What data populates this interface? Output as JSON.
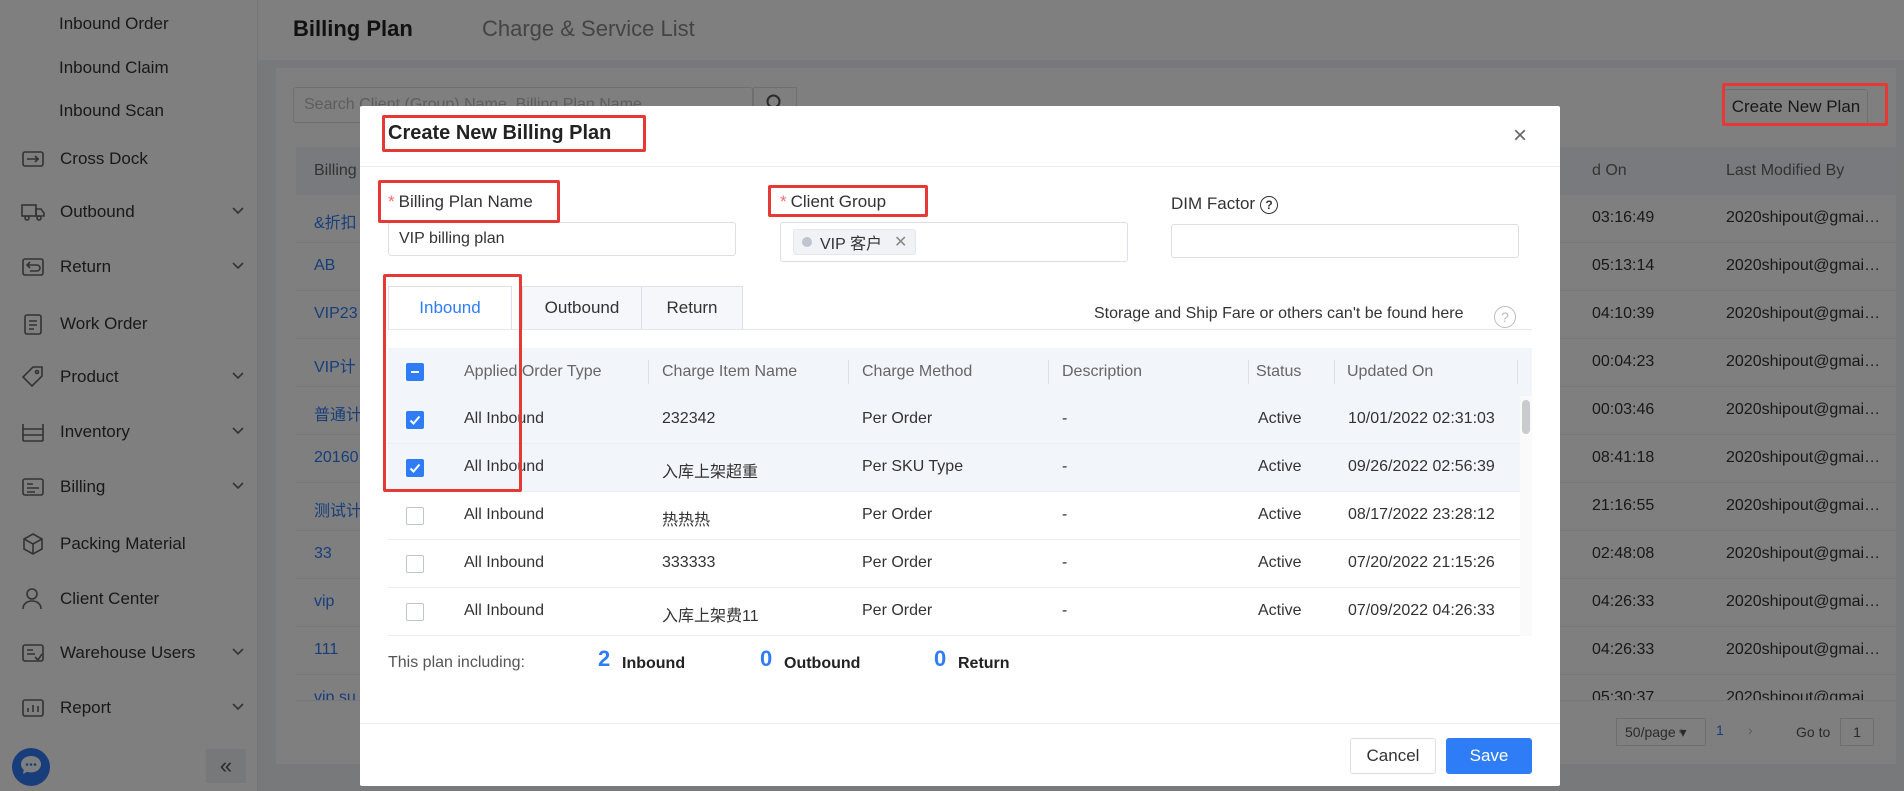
{
  "sidebar": {
    "sub_items": [
      "Inbound Order",
      "Inbound Claim",
      "Inbound Scan"
    ],
    "items": [
      {
        "label": "Cross Dock",
        "icon": "cross-dock-icon",
        "expandable": false
      },
      {
        "label": "Outbound",
        "icon": "truck-icon",
        "expandable": true
      },
      {
        "label": "Return",
        "icon": "return-icon",
        "expandable": true
      },
      {
        "label": "Work Order",
        "icon": "clipboard-icon",
        "expandable": false
      },
      {
        "label": "Product",
        "icon": "tag-icon",
        "expandable": true
      },
      {
        "label": "Inventory",
        "icon": "inventory-icon",
        "expandable": true
      },
      {
        "label": "Billing",
        "icon": "billing-icon",
        "expandable": true
      },
      {
        "label": "Packing Material",
        "icon": "box-icon",
        "expandable": false
      },
      {
        "label": "Client Center",
        "icon": "user-icon",
        "expandable": false
      },
      {
        "label": "Warehouse Users",
        "icon": "warehouse-users-icon",
        "expandable": true
      },
      {
        "label": "Report",
        "icon": "report-icon",
        "expandable": true
      }
    ],
    "collapse_symbol": "«"
  },
  "top_tabs": [
    "Billing Plan",
    "Charge & Service List"
  ],
  "page": {
    "search_placeholder": "Search Client (Group) Name, Billing Plan Name",
    "create_button": "Create New Plan",
    "columns": [
      "Billing",
      "d On",
      "Last Modified By"
    ],
    "rows": [
      {
        "name": "&折扣",
        "time": "03:16:49",
        "by": "2020shipout@gmai…"
      },
      {
        "name": "AB",
        "time": "05:13:14",
        "by": "2020shipout@gmai…"
      },
      {
        "name": "VIP23",
        "time": "04:10:39",
        "by": "2020shipout@gmai…"
      },
      {
        "name": "VIP计",
        "time": "00:04:23",
        "by": "2020shipout@gmai…"
      },
      {
        "name": "普通计",
        "time": "00:03:46",
        "by": "2020shipout@gmai…"
      },
      {
        "name": "20160",
        "time": "08:41:18",
        "by": "2020shipout@gmai…"
      },
      {
        "name": "测试计",
        "time": "21:16:55",
        "by": "2020shipout@gmai…"
      },
      {
        "name": "33",
        "time": "02:48:08",
        "by": "2020shipout@gmai…"
      },
      {
        "name": "vip",
        "time": "04:26:33",
        "by": "2020shipout@gmai…"
      },
      {
        "name": "111",
        "time": "04:26:33",
        "by": "2020shipout@gmai…"
      },
      {
        "name": "vip su",
        "time": "05:30:37",
        "by": "2020shipout@gmai…"
      }
    ],
    "pagination": {
      "page_size": "50/page",
      "current_page": "1",
      "goto_label": "Go to",
      "goto_value": "1"
    }
  },
  "dialog": {
    "title": "Create New Billing Plan",
    "fields": {
      "plan_name_label": "Billing Plan Name",
      "plan_name_value": "VIP billing plan",
      "client_group_label": "Client Group",
      "client_group_tag": "VIP 客户",
      "dim_factor_label": "DIM Factor"
    },
    "tabs": [
      "Inbound",
      "Outbound",
      "Return"
    ],
    "active_tab": "Inbound",
    "note": "Storage and Ship Fare or others can't be found here",
    "table": {
      "columns": [
        "Applied Order Type",
        "Charge Item Name",
        "Charge Method",
        "Description",
        "Status",
        "Updated On"
      ],
      "rows": [
        {
          "checked": true,
          "type": "All Inbound",
          "name": "232342",
          "method": "Per Order",
          "desc": "-",
          "status": "Active",
          "updated": "10/01/2022 02:31:03"
        },
        {
          "checked": true,
          "type": "All Inbound",
          "name": "入库上架超重",
          "method": "Per SKU Type",
          "desc": "-",
          "status": "Active",
          "updated": "09/26/2022 02:56:39"
        },
        {
          "checked": false,
          "type": "All Inbound",
          "name": "热热热",
          "method": "Per Order",
          "desc": "-",
          "status": "Active",
          "updated": "08/17/2022 23:28:12"
        },
        {
          "checked": false,
          "type": "All Inbound",
          "name": "333333",
          "method": "Per Order",
          "desc": "-",
          "status": "Active",
          "updated": "07/20/2022 21:15:26"
        },
        {
          "checked": false,
          "type": "All Inbound",
          "name": "入库上架费11",
          "method": "Per Order",
          "desc": "-",
          "status": "Active",
          "updated": "07/09/2022 04:26:33"
        }
      ]
    },
    "summary": {
      "label": "This plan including:",
      "inbound_count": "2",
      "inbound_label": "Inbound",
      "outbound_count": "0",
      "outbound_label": "Outbound",
      "return_count": "0",
      "return_label": "Return"
    },
    "cancel_label": "Cancel",
    "save_label": "Save"
  },
  "colors": {
    "accent": "#2f7df6",
    "highlight": "#e53935",
    "required": "#f56c6c"
  }
}
